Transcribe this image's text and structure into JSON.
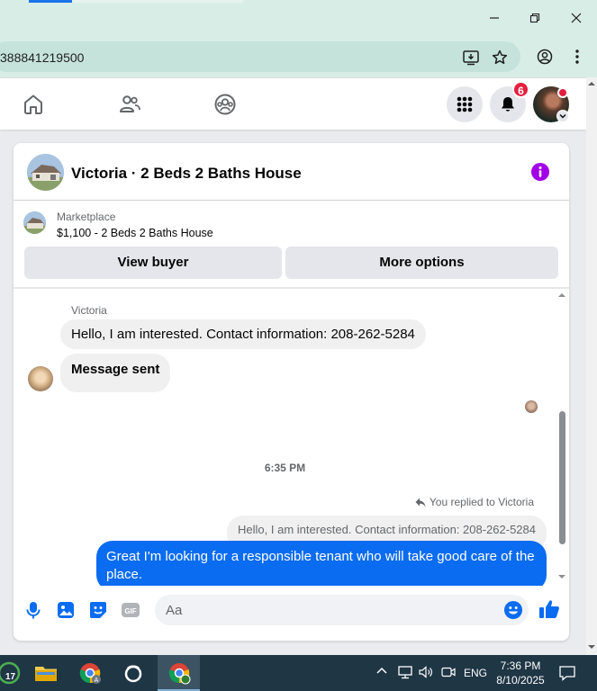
{
  "browser": {
    "url_text": "388841219500",
    "window_controls": [
      "minimize",
      "restore",
      "close"
    ],
    "icons": [
      "install-app-icon",
      "star-icon",
      "profile-icon",
      "kebab-menu-icon"
    ]
  },
  "fb_nav": {
    "notification_count": "6",
    "icons": [
      "home-icon",
      "friends-icon",
      "groups-icon",
      "menu-grid-icon",
      "bell-icon"
    ]
  },
  "chat": {
    "title": "Victoria · 2 Beds 2 Baths House",
    "marketplace_label": "Marketplace",
    "listing": "$1,100 - 2 Beds 2 Baths House",
    "view_buyer": "View buyer",
    "more_options": "More options",
    "messages": {
      "sender": "Victoria",
      "incoming_1": "Hello, I am interested. Contact information: 208-262-5284",
      "incoming_2": "Message sent",
      "timestamp": "6:35 PM",
      "replied_label": "You replied to Victoria",
      "quoted": "Hello, I am interested. Contact information: 208-262-5284",
      "outgoing": "Great I'm looking for a responsible tenant who will take good care of the place."
    },
    "composer_placeholder": "Aa",
    "accent_color": "#0a6cf0",
    "purple_info": "#a200e6"
  },
  "taskbar": {
    "notification_count": "17",
    "language": "ENG",
    "time": "7:36 PM",
    "date": "8/10/2025"
  }
}
